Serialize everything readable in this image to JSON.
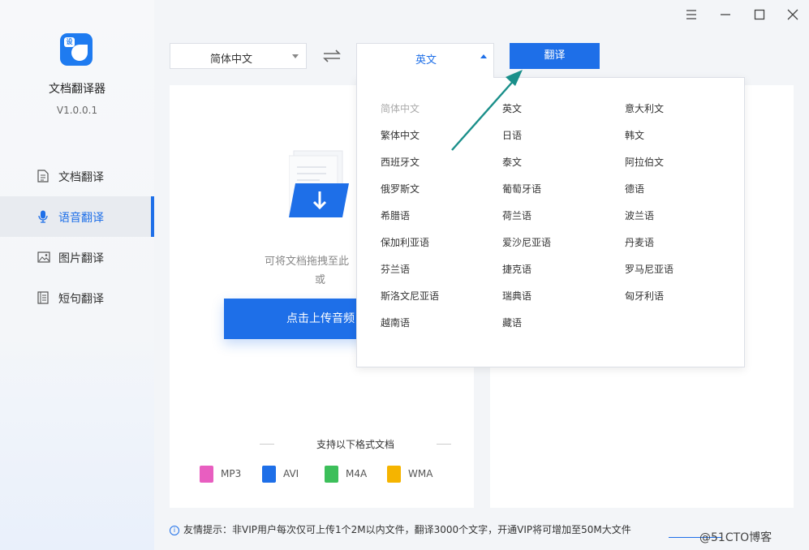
{
  "app": {
    "title": "文档翻译器",
    "version": "V1.0.0.1",
    "logo_badge": "设"
  },
  "sidebar": {
    "items": [
      {
        "label": "文档翻译",
        "icon": "document-icon",
        "active": false
      },
      {
        "label": "语音翻译",
        "icon": "microphone-icon",
        "active": true
      },
      {
        "label": "图片翻译",
        "icon": "image-icon",
        "active": false
      },
      {
        "label": "短句翻译",
        "icon": "text-lines-icon",
        "active": false
      }
    ]
  },
  "window_controls": [
    "menu-icon",
    "minimize-icon",
    "maximize-icon",
    "close-icon"
  ],
  "toolbar": {
    "source_language": "简体中文",
    "target_language": "英文",
    "translate_label": "翻译"
  },
  "upload": {
    "drop_hint": "可将文档拖拽至此",
    "or_text": "或",
    "button_label": "点击上传音频"
  },
  "formats": {
    "title": "支持以下格式文档",
    "items": [
      {
        "label": "MP3",
        "color": "#e85ec0"
      },
      {
        "label": "AVI",
        "color": "#1e6fe8"
      },
      {
        "label": "M4A",
        "color": "#3cbf5a"
      },
      {
        "label": "WMA",
        "color": "#f5b400"
      }
    ]
  },
  "language_dropdown": {
    "options": [
      {
        "label": "简体中文",
        "disabled": true
      },
      {
        "label": "英文"
      },
      {
        "label": "意大利文"
      },
      {
        "label": "繁体中文"
      },
      {
        "label": "日语"
      },
      {
        "label": "韩文"
      },
      {
        "label": "西班牙文"
      },
      {
        "label": "泰文"
      },
      {
        "label": "阿拉伯文"
      },
      {
        "label": "俄罗斯文"
      },
      {
        "label": "葡萄牙语"
      },
      {
        "label": "德语"
      },
      {
        "label": "希腊语"
      },
      {
        "label": "荷兰语"
      },
      {
        "label": "波兰语"
      },
      {
        "label": "保加利亚语"
      },
      {
        "label": "爱沙尼亚语"
      },
      {
        "label": "丹麦语"
      },
      {
        "label": "芬兰语"
      },
      {
        "label": "捷克语"
      },
      {
        "label": "罗马尼亚语"
      },
      {
        "label": "斯洛文尼亚语"
      },
      {
        "label": "瑞典语"
      },
      {
        "label": "匈牙利语"
      },
      {
        "label": "越南语"
      },
      {
        "label": "藏语"
      }
    ]
  },
  "tip": {
    "text": "友情提示：非VIP用户每次仅可上传1个2M以内文件，翻译3000个文字，开通VIP将可增加至50M大文件"
  },
  "watermark": "@51CTO博客",
  "colors": {
    "accent": "#1e6fe8",
    "arrow": "#1a8f8a"
  }
}
